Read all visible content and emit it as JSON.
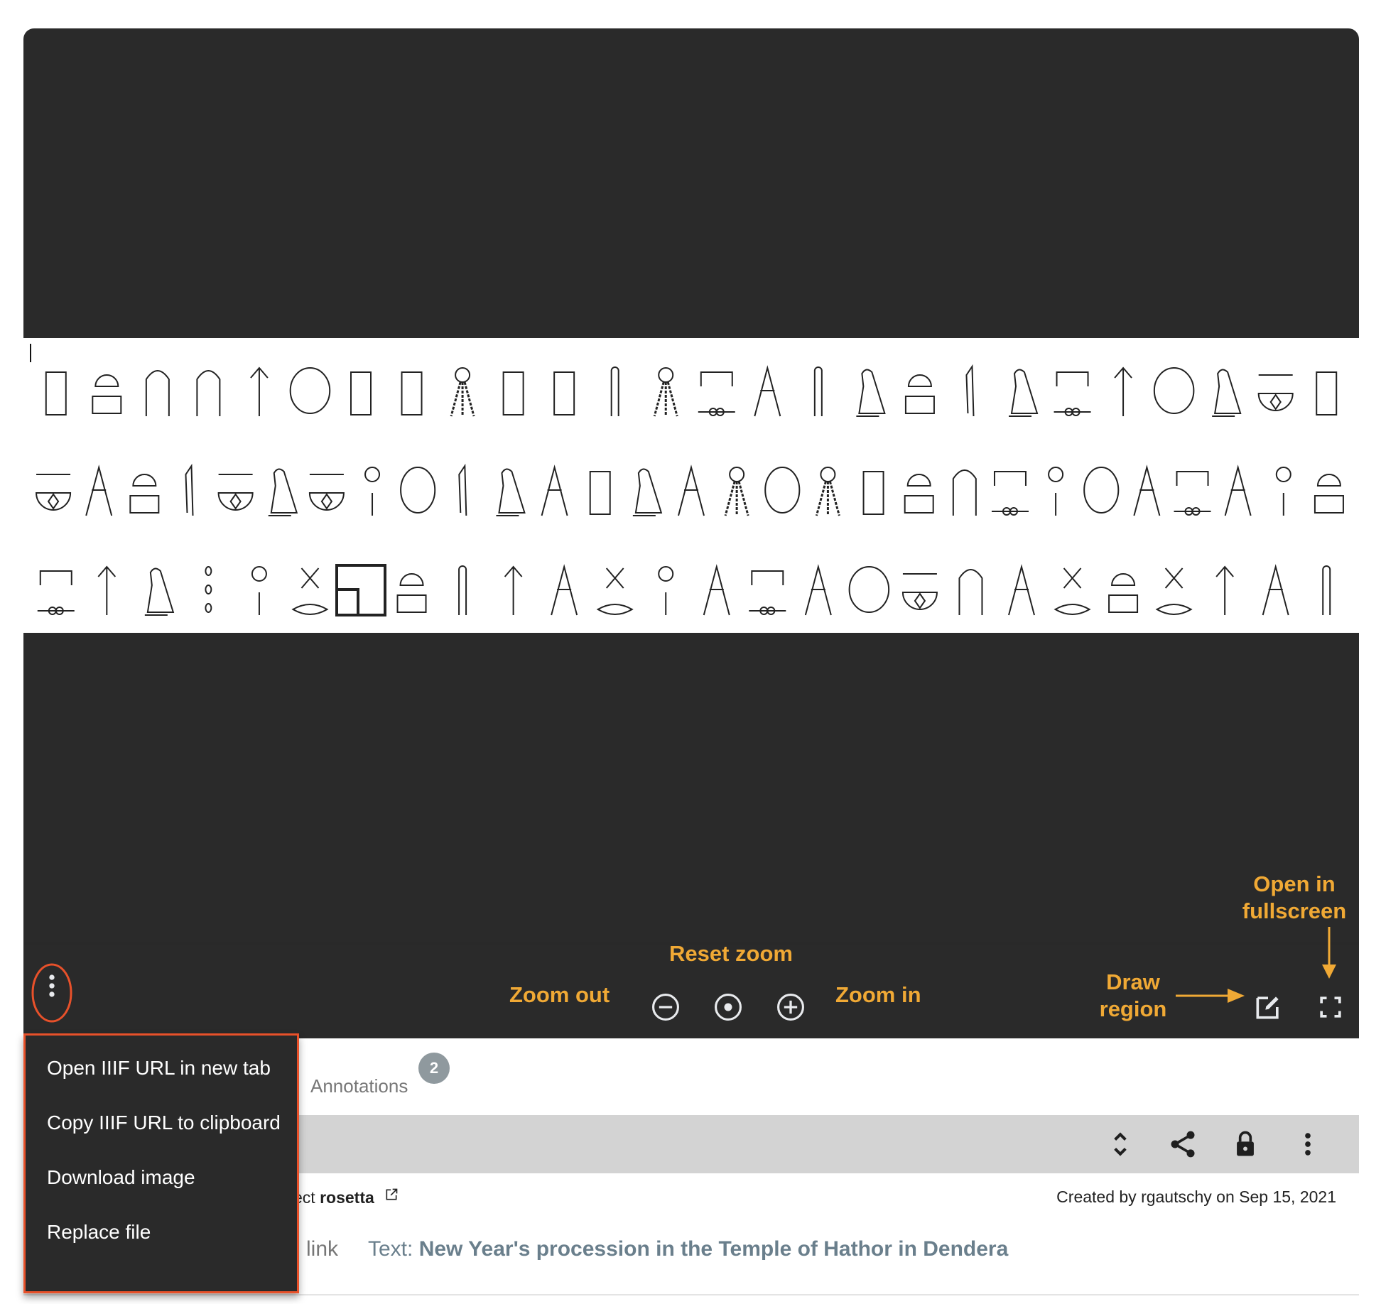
{
  "viewer": {
    "background_color": "#2a2a2a",
    "image_description": "Hieroglyphic inscription, three rows",
    "glyph_rows": [
      [
        "rect-over-bench",
        "bread-over-basket",
        "ring-stand",
        "sic-coil",
        "plant-stem",
        "lion-over-lotus",
        "horn-bow",
        "jug",
        "collar-over-loaf",
        "seated-goddess",
        "ankh-djed",
        "coil-staff",
        "bead-collar",
        "snake-over-tie",
        "jackal",
        "staff-bent",
        "owl",
        "bread-over-box",
        "knife",
        "quail",
        "door-over-tie",
        "plant-stem",
        "man-arms-raised",
        "vulture",
        "basket-over-steps",
        "sceptre"
      ],
      [
        "lotus-over-basket",
        "mace",
        "bread-pair",
        "knife",
        "tie-over-basket",
        "falcon",
        "three-baskets",
        "head-over-stroke",
        "strokes",
        "knife",
        "quail",
        "ankh",
        "djed-horns",
        "raven",
        "rope-coil",
        "bead-collar",
        "seated-figure",
        "bead-collar",
        "flag",
        "palm-bread",
        "seated-god",
        "snake-over-tie",
        "head-over-stroke",
        "hill-box",
        "rope",
        "zigzag-tie",
        "eye-over-bar",
        "head-over-stroke",
        "pot-bread"
      ],
      [
        "door-over-tie",
        "plant-stem",
        "star-over-bowl",
        "three-dots",
        "head-over-stroke",
        "wing-over-lens",
        "square-house",
        "bread-over-door",
        "staff-bent",
        "plant-stem",
        "lizard",
        "cross-over-lens",
        "head-over-stroke",
        "arm-plant",
        "legs-over-tie",
        "column",
        "paddle-over-bar",
        "basket",
        "twist",
        "pot-stand",
        "cross-over-lens",
        "coil-over-bread",
        "disk-over-lens",
        "plant-stem",
        "arm-plant",
        "staff-bent"
      ]
    ],
    "overflow_button_label": "More options"
  },
  "controls": {
    "zoom_out": {
      "icon": "zoom-out-icon",
      "annotation": "Zoom out"
    },
    "reset_zoom": {
      "icon": "reset-zoom-icon",
      "annotation": "Reset zoom"
    },
    "zoom_in": {
      "icon": "zoom-in-icon",
      "annotation": "Zoom in"
    },
    "draw_region": {
      "icon": "edit-icon",
      "annotation_line1": "Draw",
      "annotation_line2": "region"
    },
    "fullscreen": {
      "icon": "fullscreen-icon",
      "annotation_line1": "Open in",
      "annotation_line2": "fullscreen"
    },
    "annotation_color": "#f0a935",
    "highlight_color": "#e8512a"
  },
  "menu": {
    "items": [
      {
        "label": "Open IIIF URL in new tab"
      },
      {
        "label": "Copy IIIF URL to clipboard"
      },
      {
        "label": "Download image"
      },
      {
        "label": "Replace file"
      }
    ]
  },
  "tabs": {
    "annotations_label": "Annotations",
    "annotations_count": "2"
  },
  "toolbar": {
    "icons": [
      "expand-collapse-icon",
      "share-icon",
      "lock-icon",
      "more-vert-icon"
    ]
  },
  "meta": {
    "project_prefix": "ect",
    "project_name": "rosetta",
    "created": "Created by rgautschy on Sep 15, 2021",
    "link_label": "link",
    "text_prefix": "Text:",
    "text_title": "New Year's procession in the Temple of Hathor in Dendera"
  }
}
